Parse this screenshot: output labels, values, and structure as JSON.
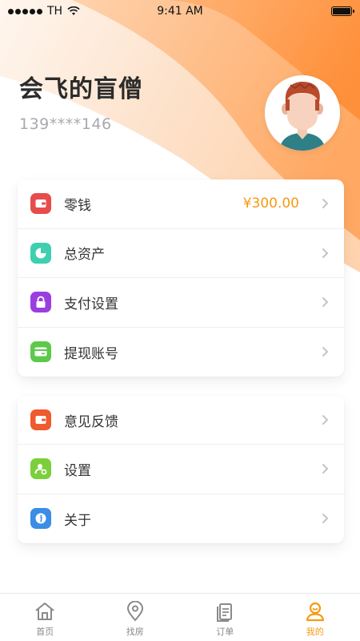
{
  "status_bar": {
    "carrier": "TH",
    "time": "9:41 AM"
  },
  "profile": {
    "name": "会飞的盲僧",
    "phone": "139****146"
  },
  "colors": {
    "accent": "#f59a12",
    "header_gradient_start": "#fde0c8",
    "header_gradient_end": "#ff8f3a"
  },
  "menu_group_1": [
    {
      "label": "零钱",
      "value": "¥300.00",
      "icon": "wallet-icon",
      "color": "#e74c4c"
    },
    {
      "label": "总资产",
      "icon": "pie-chart-icon",
      "color": "#3ecfb0"
    },
    {
      "label": "支付设置",
      "icon": "lock-icon",
      "color": "#9b3ee0"
    },
    {
      "label": "提现账号",
      "icon": "card-icon",
      "color": "#5cc94a"
    }
  ],
  "menu_group_2": [
    {
      "label": "意见反馈",
      "icon": "feedback-icon",
      "color": "#ef5a2e"
    },
    {
      "label": "设置",
      "icon": "user-settings-icon",
      "color": "#7ccf3c"
    },
    {
      "label": "关于",
      "icon": "info-icon",
      "color": "#3b8de6"
    }
  ],
  "tabbar": [
    {
      "label": "首页",
      "icon": "home-icon"
    },
    {
      "label": "找房",
      "icon": "location-icon"
    },
    {
      "label": "订单",
      "icon": "orders-icon"
    },
    {
      "label": "我的",
      "icon": "profile-icon",
      "active": true
    }
  ]
}
